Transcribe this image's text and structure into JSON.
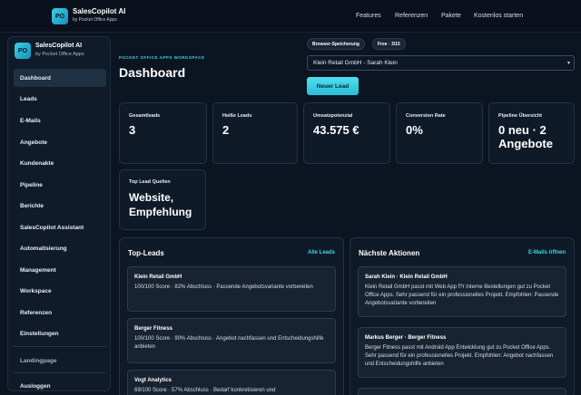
{
  "topbar": {
    "logo_text": "PO",
    "brand": "SalesCopilot AI",
    "brand_sub": "by Pocket Office Apps",
    "nav": [
      "Features",
      "Referenzen",
      "Pakete",
      "Kostenlos starten"
    ]
  },
  "sidebar": {
    "logo_text": "PO",
    "brand": "SalesCopilot AI",
    "brand_sub": "by Pocket Office Apps",
    "items": [
      "Dashboard",
      "Leads",
      "E-Mails",
      "Angebote",
      "Kundenakte",
      "Pipeline",
      "Berichte",
      "SalesCopilot Assistant",
      "Automatisierung",
      "Management",
      "Workspace",
      "Referenzen",
      "Einstellungen"
    ],
    "landing": "Landingpage",
    "logout": "Ausloggen"
  },
  "header": {
    "workspace_label": "POCKET OFFICE APPS WORKSPACE",
    "title": "Dashboard",
    "pill_storage": "Browser-Speicherung",
    "pill_plan": "Free · 3/15",
    "customer_select": "Klein Retail GmbH - Sarah Klein",
    "new_lead": "Neuer Lead"
  },
  "stats": [
    {
      "label": "Gesamtleads",
      "value": "3"
    },
    {
      "label": "Heiße Leads",
      "value": "2"
    },
    {
      "label": "Umsatzpotenzial",
      "value": "43.575 €"
    },
    {
      "label": "Conversion Rate",
      "value": "0%"
    },
    {
      "label": "Pipeline Übersicht",
      "value": "0 neu · 2 Angebote"
    }
  ],
  "sources": {
    "label": "Top Lead Quellen",
    "value": "Website, Empfehlung"
  },
  "top_leads": {
    "title": "Top-Leads",
    "link": "Alle Leads",
    "items": [
      {
        "title": "Klein Retail GmbH",
        "text": "100/100 Score · 82% Abschluss · Passende Angebotsvariante vorbereiten"
      },
      {
        "title": "Berger Fitness",
        "text": "100/100 Score · 90% Abschluss · Angebot nachfassen und Entscheidungshilfe anbieten"
      },
      {
        "title": "Vogt Analytics",
        "text": "69/100 Score · 57% Abschluss · Bedarf konkretisieren und"
      }
    ]
  },
  "next_actions": {
    "title": "Nächste Aktionen",
    "link": "E-Mails öffnen",
    "items": [
      {
        "title": "Sarah Klein · Klein Retail GmbH",
        "text": "Klein Retail GmbH passt mit Web App f?r interne Bestellungen gut zu Pocket Office Apps. Sehr passend für ein professionelles Projekt. Empfohlen: Passende Angebotsvariante vorbereiten"
      },
      {
        "title": "Markus Berger · Berger Fitness",
        "text": "Berger Fitness passt mit Android App Entwicklung gut zu Pocket Office Apps. Sehr passend für ein professionelles Projekt. Empfohlen: Angebot nachfassen und Entscheidungshilfe anbieten"
      }
    ]
  }
}
